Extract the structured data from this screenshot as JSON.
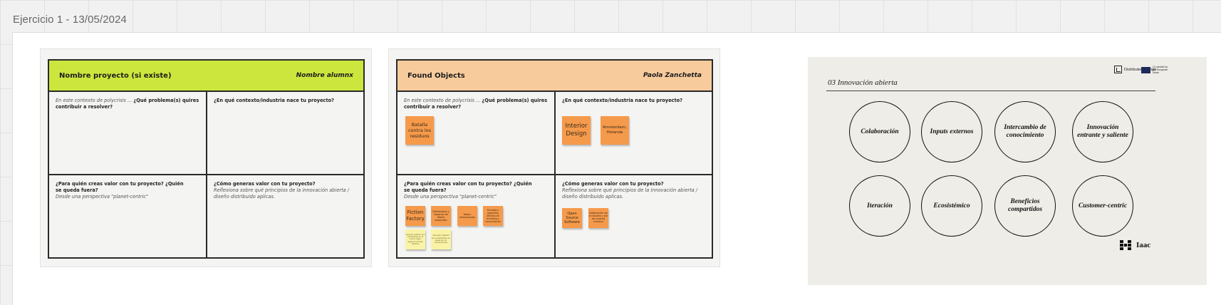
{
  "frame": {
    "title": "Ejercicio 1 - 13/05/2024"
  },
  "boards": [
    {
      "header": {
        "title": "Nombre proyecto (si existe)",
        "author": "Nombre alumnx",
        "color": "#cde63d"
      },
      "cells": {
        "q1_intro": "En este contexto de polycrisis ... ",
        "q1_bold": "¿Qué problema(s) quires contribuir a resolver?",
        "q2_bold": "¿En qué contexto/industria nace tu proyecto?",
        "q3_bold": "¿Para quién creas valor con tu proyecto? ¿Quién se queda fuera?",
        "q3_italic": "Desde una perspectiva \"planet-centric\"",
        "q4_bold": "¿Cómo generas valor con tu proyecto?",
        "q4_italic": "Reflexiona sobre qué principios de la innovación abierta / diseño distribuido aplicas."
      }
    },
    {
      "header": {
        "title": "Found Objects",
        "author": "Paola Zanchetta",
        "color": "#f7cb9c"
      },
      "cells": {
        "q1_intro": "En este contexto de polycrisis ... ",
        "q1_bold": "¿Qué problema(s) quires contribuir a resolver?",
        "q2_bold": "¿En qué contexto/industria nace tu proyecto?",
        "q3_bold": "¿Para quién creas valor con tu proyecto? ¿Quién se queda fuera?",
        "q3_italic": "Desde una perspectiva \"planet-centric\"",
        "q4_bold": "¿Cómo generas valor con tu proyecto?",
        "q4_italic": "Reflexiona sobre qué principios de la innovación abierta / diseño distribuido aplicas."
      },
      "stickies": {
        "s1": "Batalla contra los residuos",
        "s2": "Interior Design",
        "s3": "Amsterdam, Holanda",
        "s4": "Fiction Factory",
        "s5": "Diseñadores y espacios de diseño especiales",
        "s6": "Todos: restaurantes",
        "s7": "Estudios o pequeñas oficinas de branding y comunicación",
        "s8": "Open Source Software",
        "s9": "Colaboración con la industria y con los usuarios (makers)",
        "y1": "Quienes realizan sus actividades en el mismo lugar: negocios locales, familias",
        "y2": "Quienes realizan sus actividades en espacios no tradicionales"
      }
    }
  ],
  "innovation_board": {
    "title": "03 Innovación abierta",
    "logo1_text": "Distributed Design",
    "logo2_text": "Co-funded by the European Union",
    "iaac_text": "Iaac",
    "concepts": [
      "Colaboración",
      "Inputs externos",
      "Intercambio de conocimiento",
      "Innovación entrante y saliente",
      "Iteración",
      "Ecosistémico",
      "Beneficios compartidos",
      "Customer-centric"
    ]
  }
}
